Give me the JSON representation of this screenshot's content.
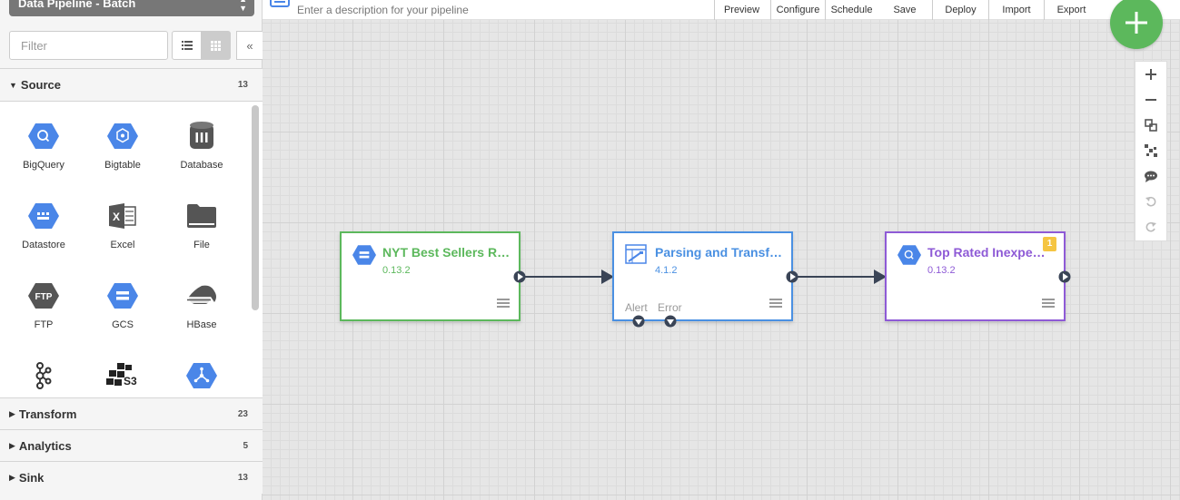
{
  "sidebar": {
    "pipeline_type": "Data Pipeline - Batch",
    "filter_placeholder": "Filter",
    "groups": [
      {
        "name": "Source",
        "count": "13"
      },
      {
        "name": "Transform",
        "count": "23"
      },
      {
        "name": "Analytics",
        "count": "5"
      },
      {
        "name": "Sink",
        "count": "13"
      }
    ],
    "plugins": [
      {
        "label": "BigQuery",
        "icon": "bigquery-icon"
      },
      {
        "label": "Bigtable",
        "icon": "bigtable-icon"
      },
      {
        "label": "Database",
        "icon": "database-icon"
      },
      {
        "label": "Datastore",
        "icon": "datastore-icon"
      },
      {
        "label": "Excel",
        "icon": "excel-icon"
      },
      {
        "label": "File",
        "icon": "file-icon"
      },
      {
        "label": "FTP",
        "icon": "ftp-icon"
      },
      {
        "label": "GCS",
        "icon": "gcs-icon"
      },
      {
        "label": "HBase",
        "icon": "hbase-icon"
      },
      {
        "label": "",
        "icon": "kafka-icon"
      },
      {
        "label": "",
        "icon": "s3-icon"
      },
      {
        "label": "",
        "icon": "pubsub-icon"
      }
    ]
  },
  "topbar": {
    "description_placeholder": "Enter a description for your pipeline",
    "buttons": [
      "Preview",
      "Configure",
      "Schedule",
      "Save",
      "Deploy",
      "Import",
      "Export"
    ]
  },
  "canvas": {
    "nodes": [
      {
        "title": "NYT Best Sellers Ra...",
        "version": "0.13.2",
        "color": "#5cb85c"
      },
      {
        "title": "Parsing and Transfo...",
        "version": "4.1.2",
        "color": "#4a90e2",
        "alert_label": "Alert",
        "error_label": "Error"
      },
      {
        "title": "Top Rated Inexpen...",
        "version": "0.13.2",
        "color": "#8e5ad6",
        "badge": "1"
      }
    ]
  },
  "colors": {
    "accent_green": "#5cb85c",
    "gcp_blue": "#4a86e8",
    "grid": "#e6e6e6"
  }
}
